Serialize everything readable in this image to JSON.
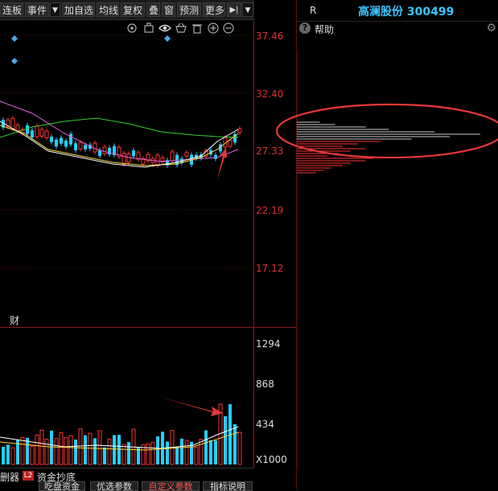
{
  "toolbar": {
    "buttons": [
      "连板",
      "事件",
      "加自选",
      "均线",
      "复权",
      "叠",
      "窗",
      "预测",
      "更多"
    ],
    "dropdown_glyph": "▼",
    "jump_glyph": "▶|"
  },
  "header": {
    "right_label": "R",
    "stock_name_code": "高澜股份 300499"
  },
  "chart_icons": [
    "gear-icon",
    "bag-icon",
    "eye-icon",
    "basket-icon",
    "trash-icon",
    "plus-icon",
    "minus-icon"
  ],
  "help": {
    "icon_glyph": "?",
    "label": "帮助",
    "gear_glyph": "⚙"
  },
  "price_axis": [
    "37.46",
    "32.40",
    "27.33",
    "22.19",
    "17.12"
  ],
  "volume_axis": [
    "1294",
    "868",
    "434",
    "X1000"
  ],
  "finance_marker": "财",
  "bottom_bar": {
    "left_tab": "删器",
    "l2_badge": "L2",
    "fund_tab": "资金抄底",
    "cells": [
      "吃盘资金",
      "优选参数",
      "自定义参数",
      "指标说明"
    ]
  },
  "colors": {
    "up": "#ff3030",
    "down": "#20d0ff",
    "ma5": "#ffffff",
    "ma10": "#ffd83a",
    "ma20": "#e060e0",
    "ma60": "#30d030",
    "annotation": "#e83838"
  }
}
